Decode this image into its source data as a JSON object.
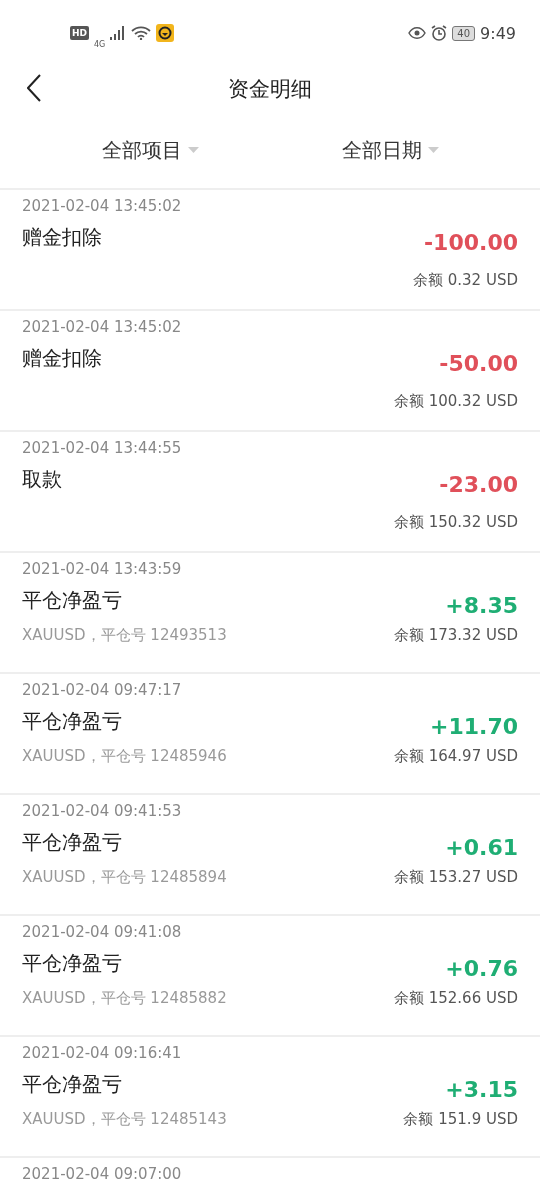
{
  "status_bar": {
    "hd": "HD",
    "network": "4G",
    "battery": "40",
    "time": "9:49"
  },
  "header": {
    "title": "资金明细"
  },
  "filters": [
    {
      "label": "全部项目"
    },
    {
      "label": "全部日期"
    }
  ],
  "records": [
    {
      "time": "2021-02-04 13:45:02",
      "title": "赠金扣除",
      "kind": "out",
      "amount": "-100.00",
      "balance": "余额 0.32 USD"
    },
    {
      "time": "2021-02-04 13:45:02",
      "title": "赠金扣除",
      "kind": "out",
      "amount": "-50.00",
      "balance": "余额 100.32 USD"
    },
    {
      "time": "2021-02-04 13:44:55",
      "title": "取款",
      "kind": "out",
      "amount": "-23.00",
      "balance": "余额 150.32 USD"
    },
    {
      "time": "2021-02-04 13:43:59",
      "title": "平仓净盈亏",
      "kind": "in",
      "amount": "+8.35",
      "detail": "XAUUSD，平仓号 12493513",
      "balance": "余额 173.32 USD"
    },
    {
      "time": "2021-02-04 09:47:17",
      "title": "平仓净盈亏",
      "kind": "in",
      "amount": "+11.70",
      "detail": "XAUUSD，平仓号 12485946",
      "balance": "余额 164.97 USD"
    },
    {
      "time": "2021-02-04 09:41:53",
      "title": "平仓净盈亏",
      "kind": "in",
      "amount": "+0.61",
      "detail": "XAUUSD，平仓号 12485894",
      "balance": "余额 153.27 USD"
    },
    {
      "time": "2021-02-04 09:41:08",
      "title": "平仓净盈亏",
      "kind": "in",
      "amount": "+0.76",
      "detail": "XAUUSD，平仓号 12485882",
      "balance": "余额 152.66 USD"
    },
    {
      "time": "2021-02-04 09:16:41",
      "title": "平仓净盈亏",
      "kind": "in",
      "amount": "+3.15",
      "detail": "XAUUSD，平仓号 12485143",
      "balance": "余额 151.9 USD"
    },
    {
      "time": "2021-02-04 09:07:00"
    }
  ]
}
